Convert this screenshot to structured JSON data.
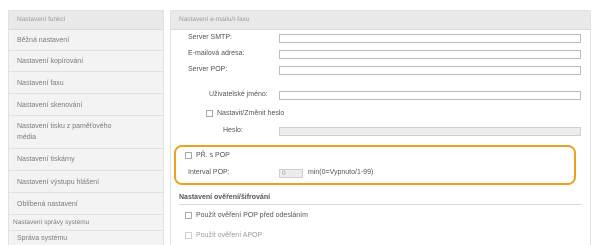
{
  "sidebar": {
    "heading": "Nastavení funkcí",
    "items": [
      {
        "label": "Běžná nastavení"
      },
      {
        "label": "Nastavení kopírování"
      },
      {
        "label": "Nastavení faxu"
      },
      {
        "label": "Nastavení skenování"
      },
      {
        "label": "Nastavení tisku z paměťového",
        "label2": "média"
      },
      {
        "label": "Nastavení tiskárny"
      },
      {
        "label": "Nastavení výstupu hlášení"
      },
      {
        "label": "Oblíbená nastavení"
      }
    ],
    "group": "Nastavení správy systému",
    "group_item": "Správa systému"
  },
  "main": {
    "heading": "Nastavení e-mailu/I-faxu",
    "smtp_label": "Server SMTP:",
    "email_label": "E-mailová adresa:",
    "pop_label": "Server POP:",
    "user_label": "Uživatelské jméno:",
    "set_pass_label": "Nastavit/Změnit heslo",
    "pass_label": "Heslo:",
    "rx_pop_label": "PŘ. s POP",
    "poll_label": "Interval POP:",
    "poll_value": "0",
    "poll_unit": "min(0=Vypnuto/1-99)",
    "auth_heading": "Nastavení ověření/šifrování",
    "pop_before_smtp_label": "Použít ověření POP před odesláním",
    "apop_label": "Použít ověření APOP"
  }
}
